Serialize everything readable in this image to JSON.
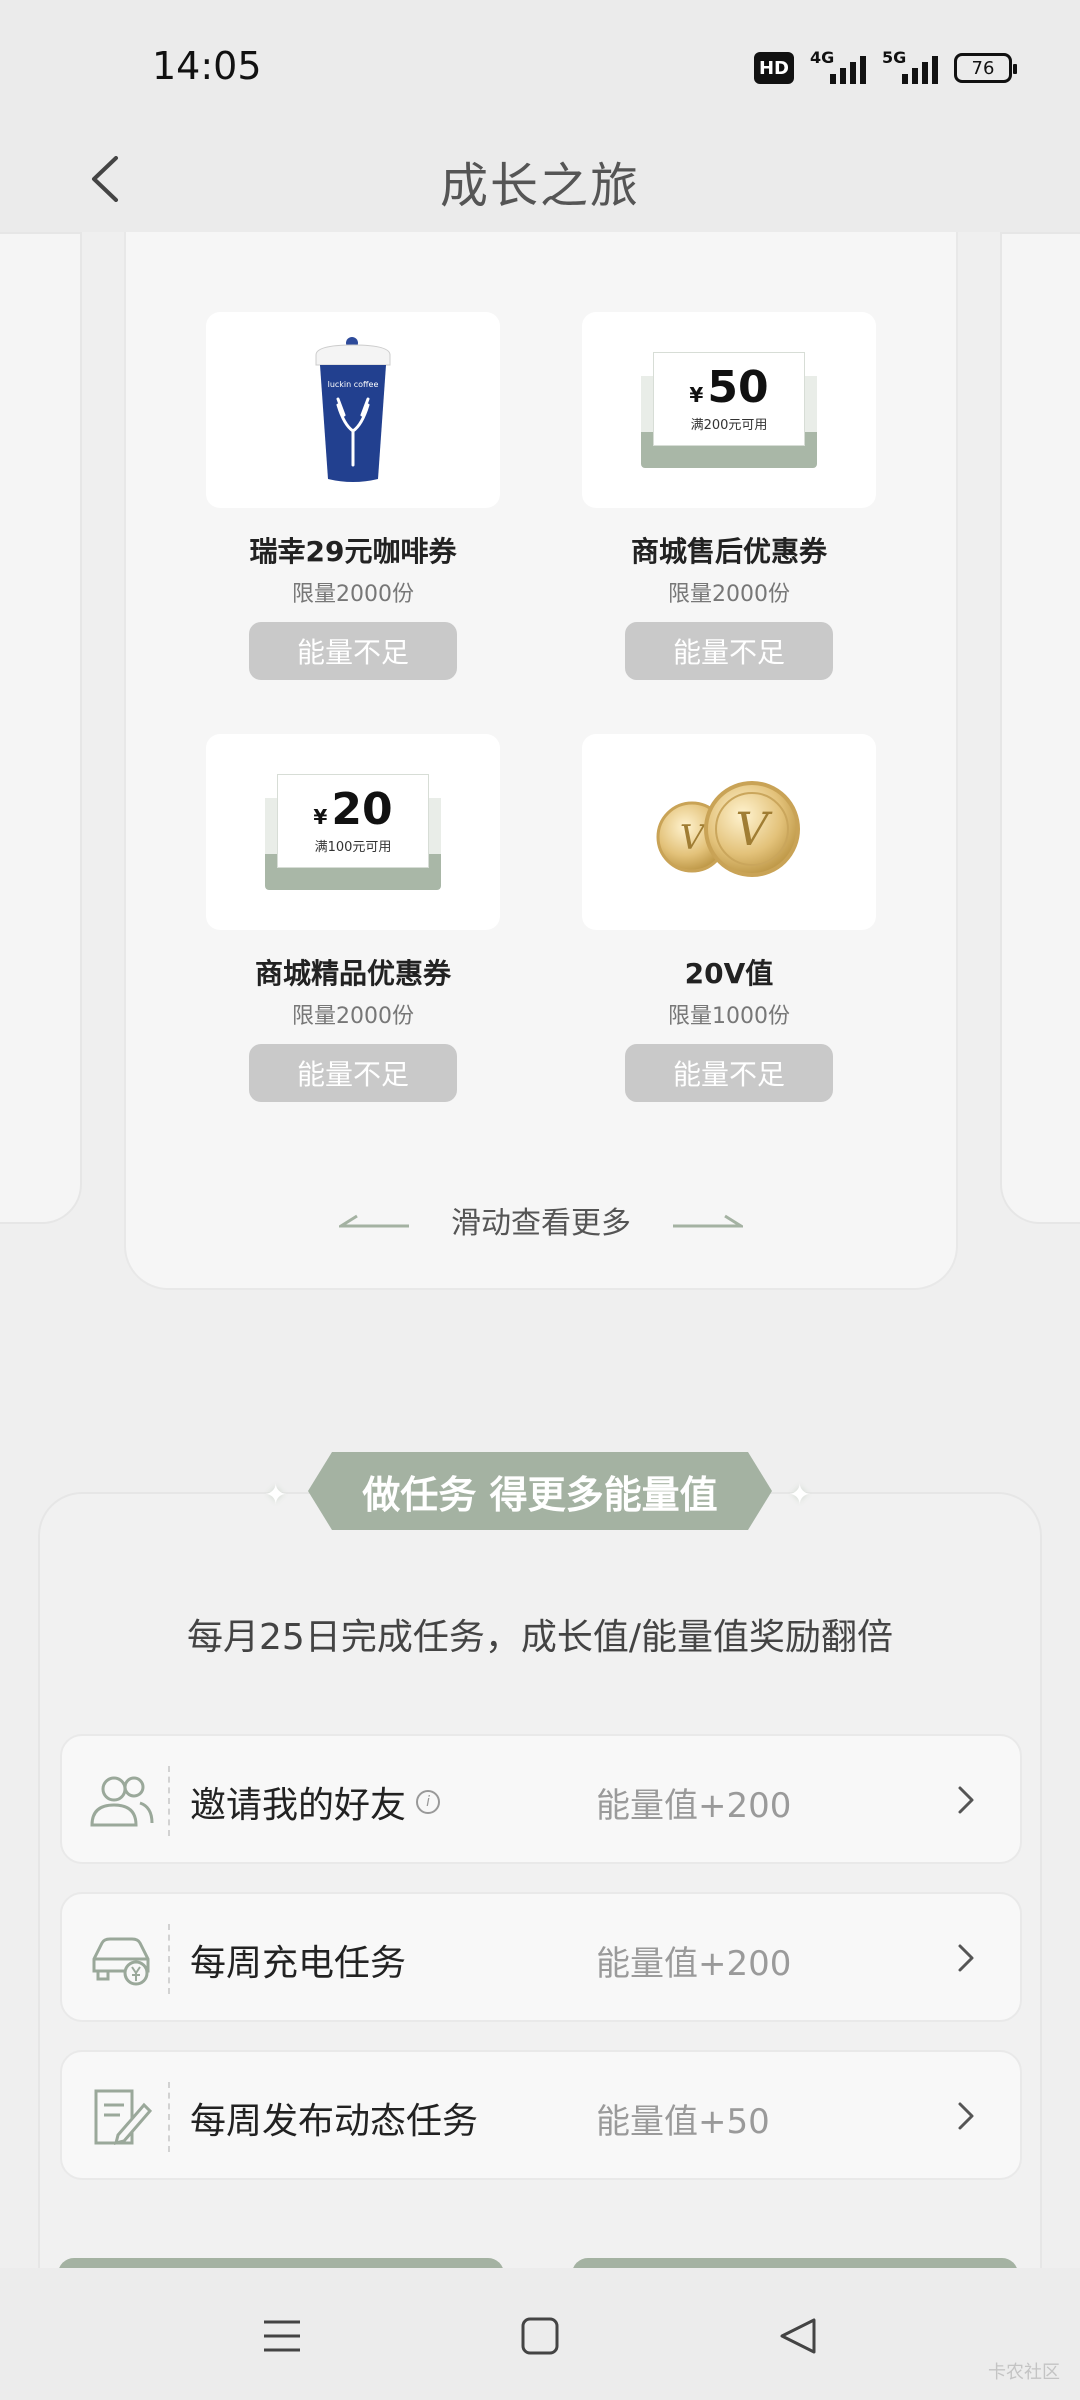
{
  "status_bar": {
    "time": "14:05",
    "hd": "HD",
    "net1": "4G",
    "net2": "5G",
    "battery": "76"
  },
  "header": {
    "title": "成长之旅",
    "back_icon": "chevron-left-icon"
  },
  "rewards": [
    {
      "name": "瑞幸29元咖啡券",
      "limit": "限量2000份",
      "button": "能量不足",
      "art": "coffee-cup",
      "art_text": "luckin coffee"
    },
    {
      "name": "商城售后优惠券",
      "limit": "限量2000份",
      "button": "能量不足",
      "art": "coupon",
      "currency": "¥",
      "amount": "50",
      "condition": "满200元可用"
    },
    {
      "name": "商城精品优惠券",
      "limit": "限量2000份",
      "button": "能量不足",
      "art": "coupon",
      "currency": "¥",
      "amount": "20",
      "condition": "满100元可用"
    },
    {
      "name": "20V值",
      "limit": "限量1000份",
      "button": "能量不足",
      "art": "v-coins",
      "coin_letter": "V"
    }
  ],
  "swipe_hint": "滑动查看更多",
  "tasks_section": {
    "banner": "做任务 得更多能量值",
    "subtitle": "每月25日完成任务，成长值/能量值奖励翻倍",
    "tasks": [
      {
        "name": "邀请我的好友",
        "reward": "能量值+200",
        "icon": "friends-icon",
        "has_info": true,
        "info_glyph": "i"
      },
      {
        "name": "每周充电任务",
        "reward": "能量值+200",
        "icon": "car-charge-icon",
        "has_info": false
      },
      {
        "name": "每周发布动态任务",
        "reward": "能量值+50",
        "icon": "edit-post-icon",
        "has_info": false
      }
    ]
  },
  "nav": {
    "menu_icon": "menu-icon",
    "home_icon": "home-square-icon",
    "back_icon": "back-triangle-icon"
  },
  "watermark": "卡农社区",
  "colors": {
    "accent": "#a4b2a2",
    "button_disabled": "#c9c9c9",
    "background": "#efefef"
  }
}
